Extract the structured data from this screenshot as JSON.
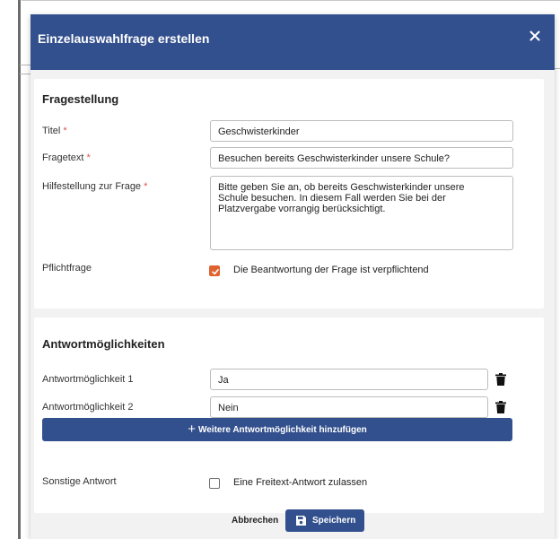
{
  "modal": {
    "title": "Einzelauswahlfrage erstellen",
    "close_icon": "close-icon"
  },
  "question_section": {
    "heading": "Fragestellung",
    "title_label": "Titel",
    "title_value": "Geschwisterkinder",
    "text_label": "Fragetext",
    "text_value": "Besuchen bereits Geschwisterkinder unsere Schule?",
    "help_label": "Hilfestellung zur Frage",
    "help_value": "Bitte geben Sie an, ob bereits Geschwisterkinder unsere\nSchule besuchen. In diesem Fall werden Sie bei der\nPlatzvergabe vorrangig berücksichtigt.",
    "required_marker": "*",
    "mandatory_label": "Pflichtfrage",
    "mandatory_checkbox_label": "Die Beantwortung der Frage ist verpflichtend",
    "mandatory_checked": true
  },
  "answers_section": {
    "heading": "Antwortmöglichkeiten",
    "options": [
      {
        "label": "Antwortmöglichkeit 1",
        "value": "Ja"
      },
      {
        "label": "Antwortmöglichkeit 2",
        "value": "Nein"
      }
    ],
    "add_button_label": "Weitere Antwortmöglichkeit hinzufügen",
    "add_button_icon": "plus-icon",
    "other_label": "Sonstige Antwort",
    "other_checkbox_label": "Eine Freitext-Antwort zulassen",
    "other_checked": false
  },
  "footer": {
    "cancel_label": "Abbrechen",
    "save_label": "Speichern",
    "save_icon": "floppy-disk-icon"
  },
  "colors": {
    "primary": "#33508e",
    "accent_checkbox": "#e0622f",
    "required_marker": "#d9534f"
  }
}
